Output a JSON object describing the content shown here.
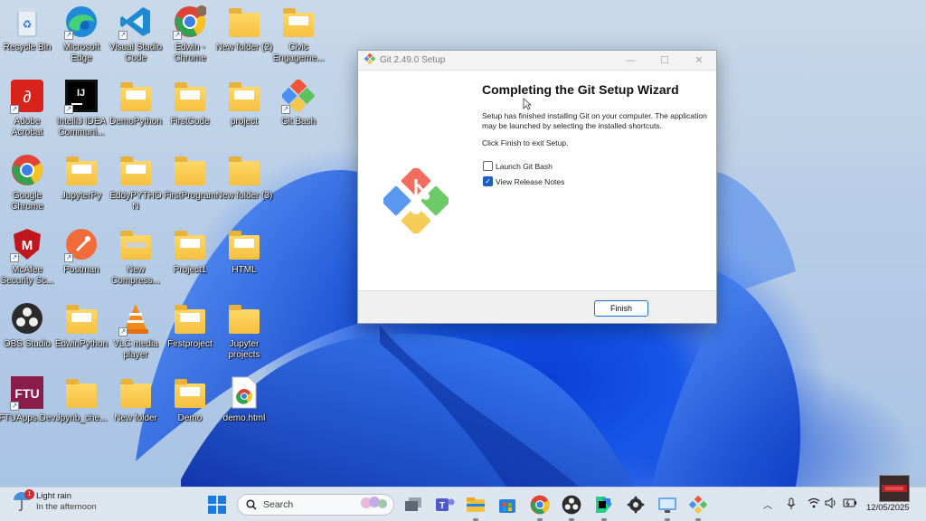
{
  "desktop": {
    "icons": [
      {
        "label": "Recycle Bin"
      },
      {
        "label": "Microsoft Edge"
      },
      {
        "label": "Visual Studio Code"
      },
      {
        "label": "Edwin - Chrome"
      },
      {
        "label": "New folder (2)"
      },
      {
        "label": "Civic Engageme..."
      },
      {
        "label": "Adobe Acrobat"
      },
      {
        "label": "IntelliJ IDEA Communi..."
      },
      {
        "label": "DemoPython"
      },
      {
        "label": "FirstCode"
      },
      {
        "label": "project"
      },
      {
        "label": "Git Bash"
      },
      {
        "label": "Google Chrome"
      },
      {
        "label": "JupyterPy"
      },
      {
        "label": "EddyPYTHON"
      },
      {
        "label": "FirstProgram"
      },
      {
        "label": "New folder (3)"
      },
      {
        "label": "McAfee Security Sc..."
      },
      {
        "label": "Postman"
      },
      {
        "label": "New Compress..."
      },
      {
        "label": "Project1"
      },
      {
        "label": "HTML"
      },
      {
        "label": "OBS Studio"
      },
      {
        "label": "EdwinPython"
      },
      {
        "label": "VLC media player"
      },
      {
        "label": "Firstproject"
      },
      {
        "label": "Jupyter projects"
      },
      {
        "label": "FTUApps.Dev"
      },
      {
        "label": "Jpynb_che..."
      },
      {
        "label": "New folder"
      },
      {
        "label": "Demo"
      },
      {
        "label": "demo.html"
      }
    ]
  },
  "dialog": {
    "title": "Git 2.49.0 Setup",
    "heading": "Completing the Git Setup Wizard",
    "text1": "Setup has finished installing Git on your computer. The application may be launched by selecting the installed shortcuts.",
    "text2": "Click Finish to exit Setup.",
    "checkbox_launch": "Launch Git Bash",
    "checkbox_launch_checked": false,
    "checkbox_notes": "View Release Notes",
    "checkbox_notes_checked": true,
    "finish_label": "Finish",
    "minimize": "—",
    "maximize": "☐",
    "close": "✕"
  },
  "taskbar": {
    "weather_title": "Light rain",
    "weather_sub": "In the afternoon",
    "weather_badge": "1",
    "search_placeholder": "Search",
    "date": "12/05/2025"
  },
  "colors": {
    "accent": "#1b5fc1",
    "taskbar_bg": "#dde6ef",
    "folder": "#f5c040"
  }
}
